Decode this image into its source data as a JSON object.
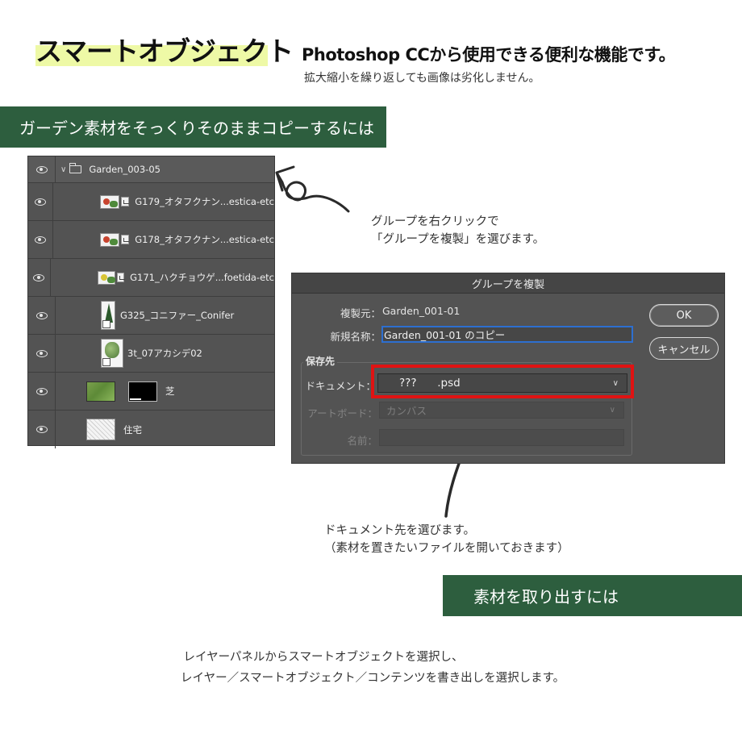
{
  "header": {
    "title": "スマートオブジェクト",
    "subtitle": "Photoshop CCから使用できる便利な機能です。",
    "description": "拡大縮小を繰り返しても画像は劣化しません。"
  },
  "section1": {
    "banner": "ガーデン素材をそっくりそのままコピーするには"
  },
  "layers": {
    "group_name": "Garden_003-05",
    "items": [
      {
        "name": "G179_オタフクナン...estica-etc"
      },
      {
        "name": "G178_オタフクナン...estica-etc"
      },
      {
        "name": "G171_ハクチョウゲ...foetida-etc"
      },
      {
        "name": "G325_コニファー_Conifer"
      },
      {
        "name": "3t_07アカシデ02"
      },
      {
        "name": "芝"
      },
      {
        "name": "住宅"
      }
    ]
  },
  "notes": {
    "right_click_line1": "グループを右クリックで",
    "right_click_line2": "「グループを複製」を選びます。",
    "document_line1": "ドキュメント先を選びます。",
    "document_line2": "（素材を置きたいファイルを開いておきます）"
  },
  "dialog": {
    "title": "グループを複製",
    "source_label": "複製元：",
    "source_value": "Garden_001-01",
    "new_name_label": "新規名称：",
    "new_name_value": "Garden_001-01 のコピー",
    "destination_label": "保存先",
    "document_label": "ドキュメント：",
    "document_value": "???      .psd",
    "artboard_label": "アートボード：",
    "artboard_value": "カンバス",
    "name_label": "名前：",
    "name_value": "",
    "ok_label": "OK",
    "cancel_label": "キャンセル"
  },
  "section2": {
    "banner": "素材を取り出すには",
    "line1": "レイヤーパネルからスマートオブジェクトを選択し、",
    "line2": "レイヤー／スマートオブジェクト／コンテンツを書き出しを選択します。"
  },
  "colors": {
    "banner_green": "#2d5e3e",
    "title_highlight": "#eef9a6",
    "panel_gray": "#535353",
    "red_highlight": "#e01313",
    "focus_blue": "#2d6fd0"
  },
  "icons": [
    "eye-icon",
    "folder-icon",
    "chevron-down-icon",
    "smart-object-badge-icon"
  ]
}
